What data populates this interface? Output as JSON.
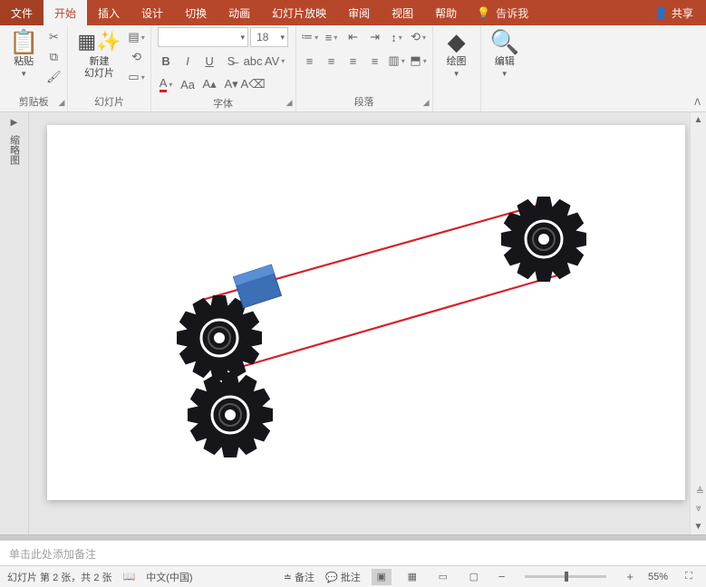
{
  "tabs": {
    "file": "文件",
    "home": "开始",
    "insert": "插入",
    "design": "设计",
    "transitions": "切换",
    "animations": "动画",
    "slideshow": "幻灯片放映",
    "review": "审阅",
    "view": "视图",
    "help": "帮助",
    "tell_me": "告诉我",
    "share": "共享"
  },
  "ribbon": {
    "clipboard": {
      "label": "剪贴板",
      "paste": "粘贴"
    },
    "slides": {
      "label": "幻灯片",
      "new_slide": "新建\n幻灯片"
    },
    "font": {
      "label": "字体",
      "name": "",
      "size": "18"
    },
    "paragraph": {
      "label": "段落"
    },
    "drawing": {
      "label": "绘图"
    },
    "editing": {
      "label": "编辑"
    }
  },
  "outline_label": "缩略图",
  "notes_placeholder": "单击此处添加备注",
  "status": {
    "slide_info": "幻灯片 第 2 张，共 2 张",
    "language": "中文(中国)",
    "notes": "备注",
    "comments": "批注",
    "zoom": "55%"
  }
}
